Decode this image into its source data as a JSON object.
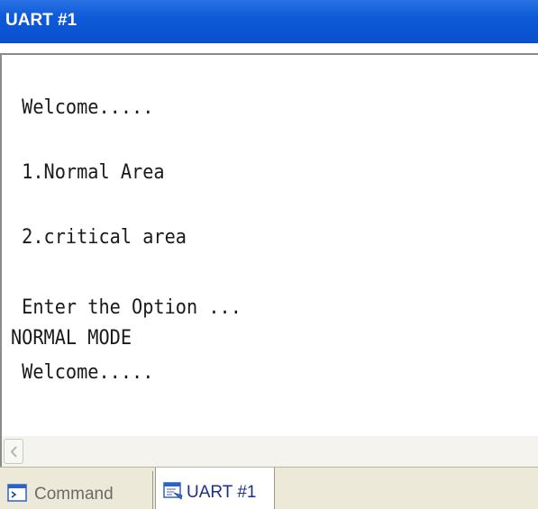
{
  "window": {
    "title": "UART #1"
  },
  "terminal": {
    "lines": [
      " Welcome.....",
      " 1.Normal Area",
      " 2.critical area",
      " Enter the Option ...",
      "NORMAL MODE",
      " Welcome....."
    ]
  },
  "tabs": [
    {
      "label": "Command",
      "icon": "command-window-icon",
      "active": false
    },
    {
      "label": "UART #1",
      "icon": "uart-serial-window-icon",
      "active": true
    }
  ],
  "colors": {
    "titlebar": "#0a4fcc",
    "tab_active_text": "#1c2f8a",
    "tab_inactive_text": "#6b6b6b"
  }
}
